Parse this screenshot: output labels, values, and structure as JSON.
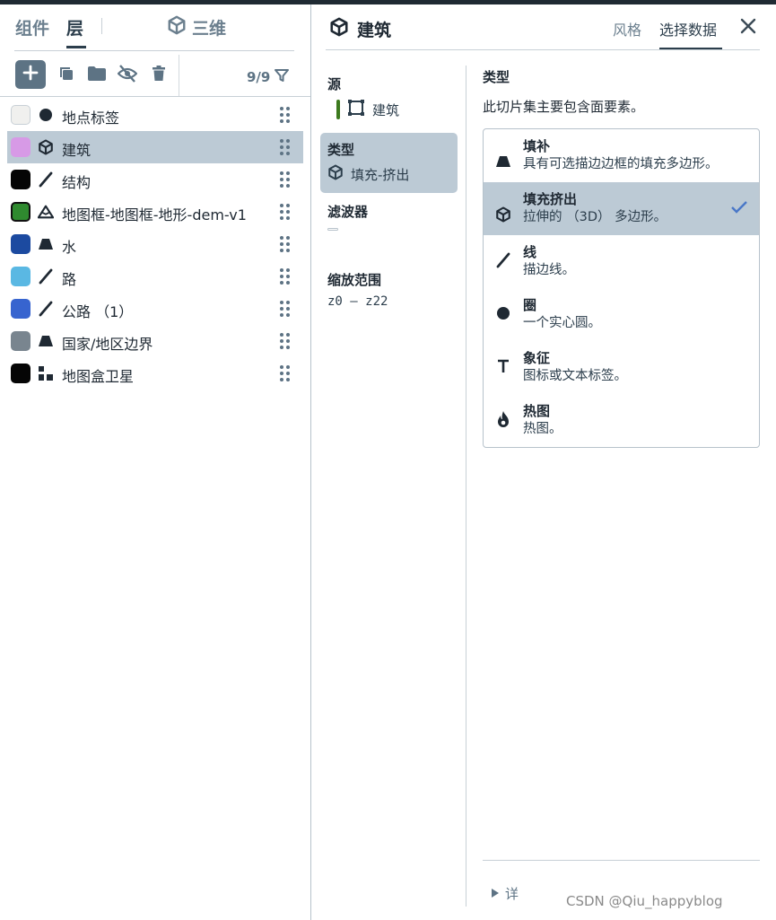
{
  "left_panel": {
    "tabs": [
      {
        "label": "组件"
      },
      {
        "label": "层"
      }
    ],
    "tab_3d": {
      "label": "三维",
      "icon": "cube-icon"
    },
    "toolbar": {
      "add_icon": "plus-icon",
      "duplicate_icon": "copy-icon",
      "folder_icon": "folder-icon",
      "hide_icon": "eye-off-icon",
      "delete_icon": "trash-icon",
      "count": "9/9",
      "filter_icon": "filter-icon"
    },
    "layers": [
      {
        "label": "地点标签",
        "color": "#f0f0ee",
        "icon": "circle-icon"
      },
      {
        "label": "建筑",
        "color": "#d79ae6",
        "icon": "cube-icon",
        "selected": true
      },
      {
        "label": "结构",
        "color": "#050505",
        "icon": "line-icon"
      },
      {
        "label": "地图框-地图框-地形-dem-v1",
        "color": "#2f8a2f",
        "icon": "mountain-icon"
      },
      {
        "label": "水",
        "color": "#1c4aa0",
        "icon": "fill-icon"
      },
      {
        "label": "路",
        "color": "#5ab8e3",
        "icon": "line-icon"
      },
      {
        "label": "公路 （1）",
        "color": "#3764cf",
        "icon": "line-icon"
      },
      {
        "label": "国家/地区边界",
        "color": "#79858f",
        "icon": "fill-icon"
      },
      {
        "label": "地图盒卫星",
        "color": "#050505",
        "icon": "raster-icon"
      }
    ]
  },
  "right_panel": {
    "title": "建筑",
    "title_icon": "cube-icon",
    "tabs": [
      {
        "label": "风格"
      },
      {
        "label": "选择数据"
      }
    ],
    "close_icon": "close-icon",
    "nav": {
      "source": {
        "label": "源",
        "value": "建筑"
      },
      "type": {
        "label": "类型",
        "value": "填充-挤出"
      },
      "filter": {
        "label": "滤波器"
      },
      "zoom": {
        "label": "缩放范围",
        "value": "z0 – z22"
      }
    },
    "content": {
      "title": "类型",
      "description": "此切片集主要包含面要素。",
      "types": [
        {
          "name": "填补",
          "desc": "具有可选描边边框的填充多边形。",
          "icon": "fill-icon"
        },
        {
          "name": "填充挤出",
          "desc": "拉伸的 （3D） 多边形。",
          "icon": "cube-icon",
          "selected": true
        },
        {
          "name": "线",
          "desc": "描边线。",
          "icon": "line-icon"
        },
        {
          "name": "圈",
          "desc": "一个实心圆。",
          "icon": "circle-icon"
        },
        {
          "name": "象征",
          "desc": "图标或文本标签。",
          "icon": "text-icon"
        },
        {
          "name": "热图",
          "desc": "热图。",
          "icon": "flame-icon"
        }
      ]
    },
    "details_label": "详"
  },
  "watermark": "CSDN @Qiu_happyblog",
  "colors": {
    "accent": "#5d7384",
    "selected_bg": "#bccad5",
    "check": "#4a78c8",
    "source_bar": "#3c7a1e"
  }
}
